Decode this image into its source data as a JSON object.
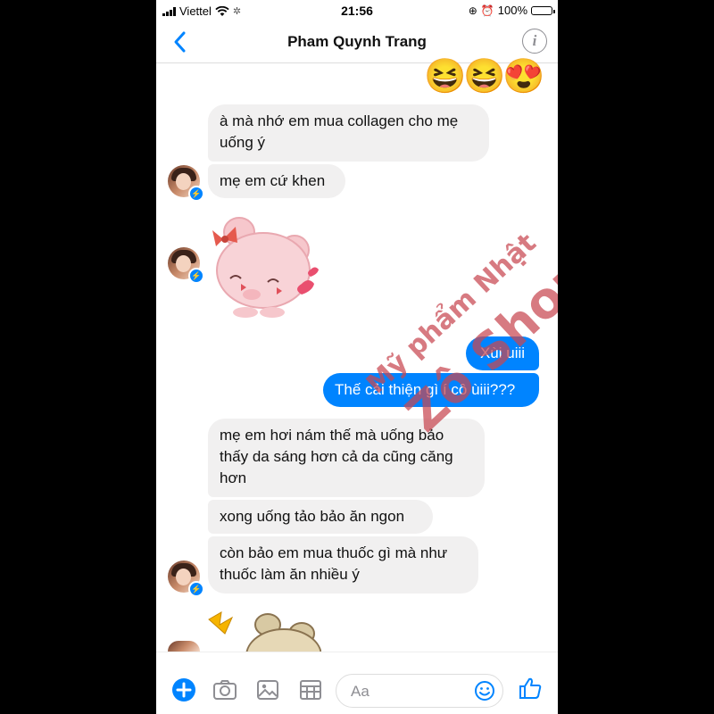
{
  "status": {
    "carrier": "Viettel",
    "time": "21:56",
    "battery": "100%",
    "battery_level": 1.0
  },
  "header": {
    "title": "Pham Quynh Trang"
  },
  "emoji_row": [
    "😆",
    "😆",
    "😍"
  ],
  "messages": {
    "m1": "à mà nhớ em mua collagen cho mẹ uống ý",
    "m2": "mẹ em cứ khen",
    "m3": "Xùi uiii",
    "m4": "Thế cải thiện gì í cô ùiii???",
    "m5": "mẹ em hơi nám thế mà uống bảo thấy da sáng hơn cả da cũng căng hơn",
    "m6": "xong uống tảo bảo ăn ngon",
    "m7": "còn bảo em mua thuốc gì mà như thuốc làm ăn nhiều ý"
  },
  "watermark": {
    "line1": "Mỹ phẩm Nhật",
    "line2": "Zô Shop"
  },
  "composer": {
    "placeholder": "Aa"
  },
  "colors": {
    "accent": "#0084ff",
    "incoming_bubble": "#f1f0f0",
    "watermark": "#c84650"
  },
  "icons": [
    "back-chevron-icon",
    "info-icon",
    "plus-icon",
    "camera-icon",
    "gallery-icon",
    "grid-icon",
    "emoji-icon",
    "thumbs-up-icon",
    "messenger-badge-icon"
  ]
}
